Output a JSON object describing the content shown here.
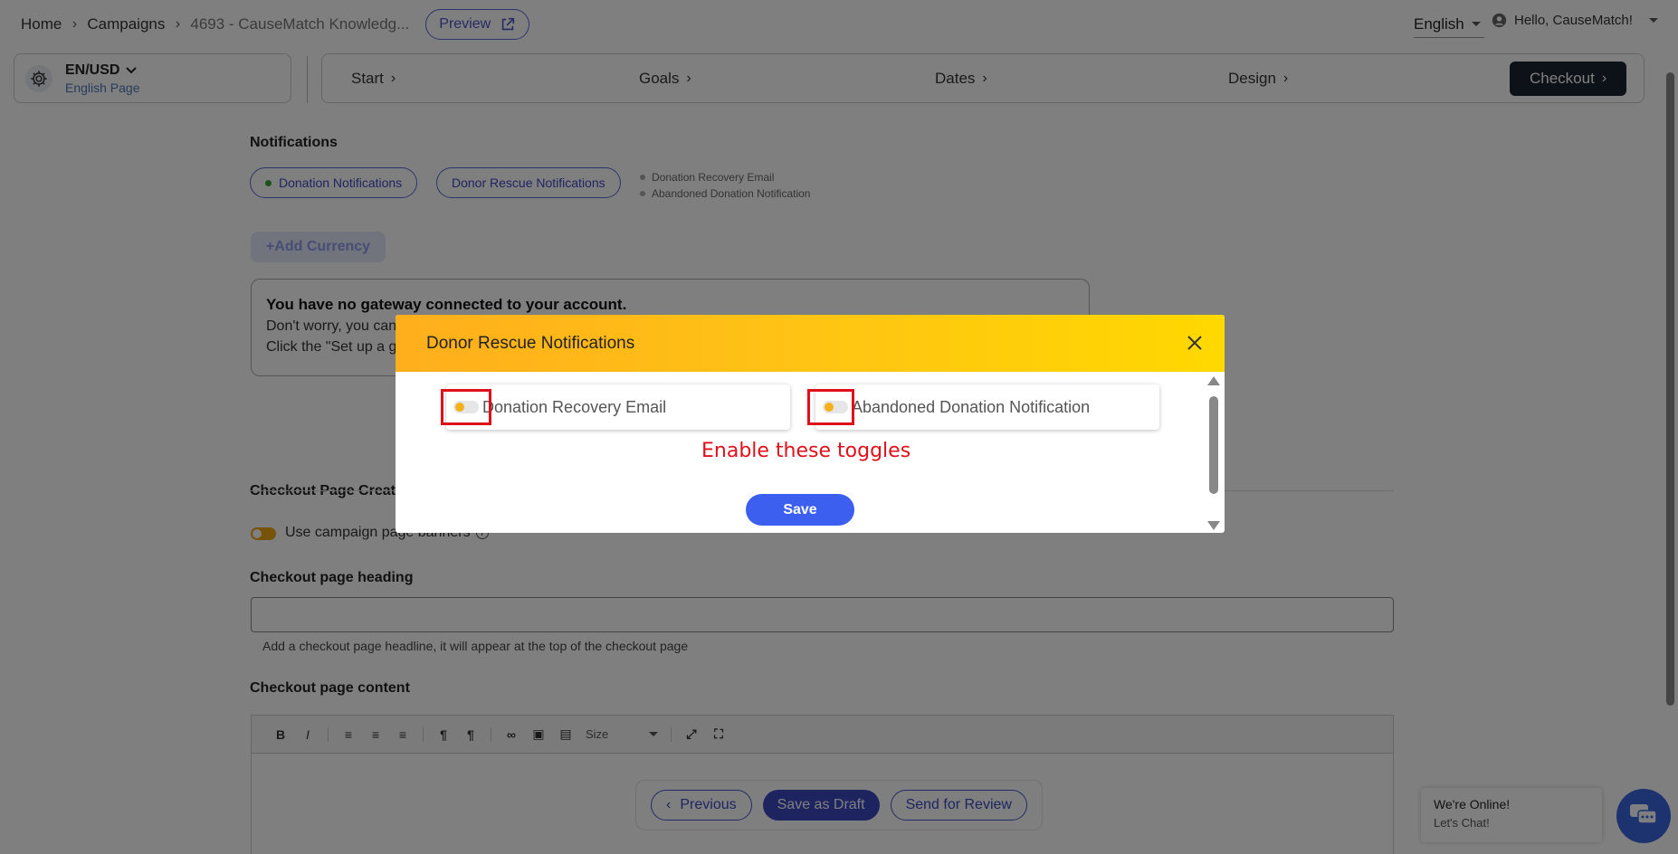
{
  "breadcrumb": {
    "home": "Home",
    "campaigns": "Campaigns",
    "current": "4693 - CauseMatch Knowledg...",
    "separator": "›"
  },
  "header": {
    "preview_label": "Preview",
    "language": "English",
    "user_greeting": "Hello, CauseMatch!"
  },
  "locale": {
    "title": "EN/USD",
    "subtitle": "English Page"
  },
  "stepper": {
    "steps": [
      {
        "label": "Start"
      },
      {
        "label": "Goals"
      },
      {
        "label": "Dates"
      },
      {
        "label": "Design"
      },
      {
        "label": "Checkout"
      }
    ],
    "chevron": "›"
  },
  "notifications": {
    "title": "Notifications",
    "pill_donation": "Donation Notifications",
    "pill_rescue": "Donor Rescue Notifications",
    "list": [
      "Donation Recovery Email",
      "Abandoned Donation Notification"
    ]
  },
  "currency": {
    "add_label": "+Add Currency"
  },
  "gateway": {
    "heading": "You have no gateway connected to your account.",
    "line1": "Don't worry, you can",
    "line2": "Click the \"Set up a g"
  },
  "checkout": {
    "creative_title": "Checkout Page Creativ",
    "banner_label": "Use campaign page banners",
    "heading_label": "Checkout page heading",
    "heading_value": "",
    "heading_helper": "Add a checkout page headline, it will appear at the top of the checkout page",
    "content_label": "Checkout page content",
    "toolbar_size": "Size"
  },
  "actions": {
    "previous": "Previous",
    "save_draft": "Save as Draft",
    "send_review": "Send for Review"
  },
  "chat": {
    "line1": "We're Online!",
    "line2": "Let's Chat!"
  },
  "modal": {
    "title": "Donor Rescue Notifications",
    "toggle1_label": "Donation Recovery Email",
    "toggle2_label": "Abandoned Donation Notification",
    "annotation": "Enable these toggles",
    "save_label": "Save"
  },
  "colors": {
    "accent": "#3c48c0",
    "modal_header_start": "#ffae1c",
    "modal_header_end": "#ffd800",
    "annotation_red": "#e0101a",
    "toggle_orange": "#f0a817"
  }
}
